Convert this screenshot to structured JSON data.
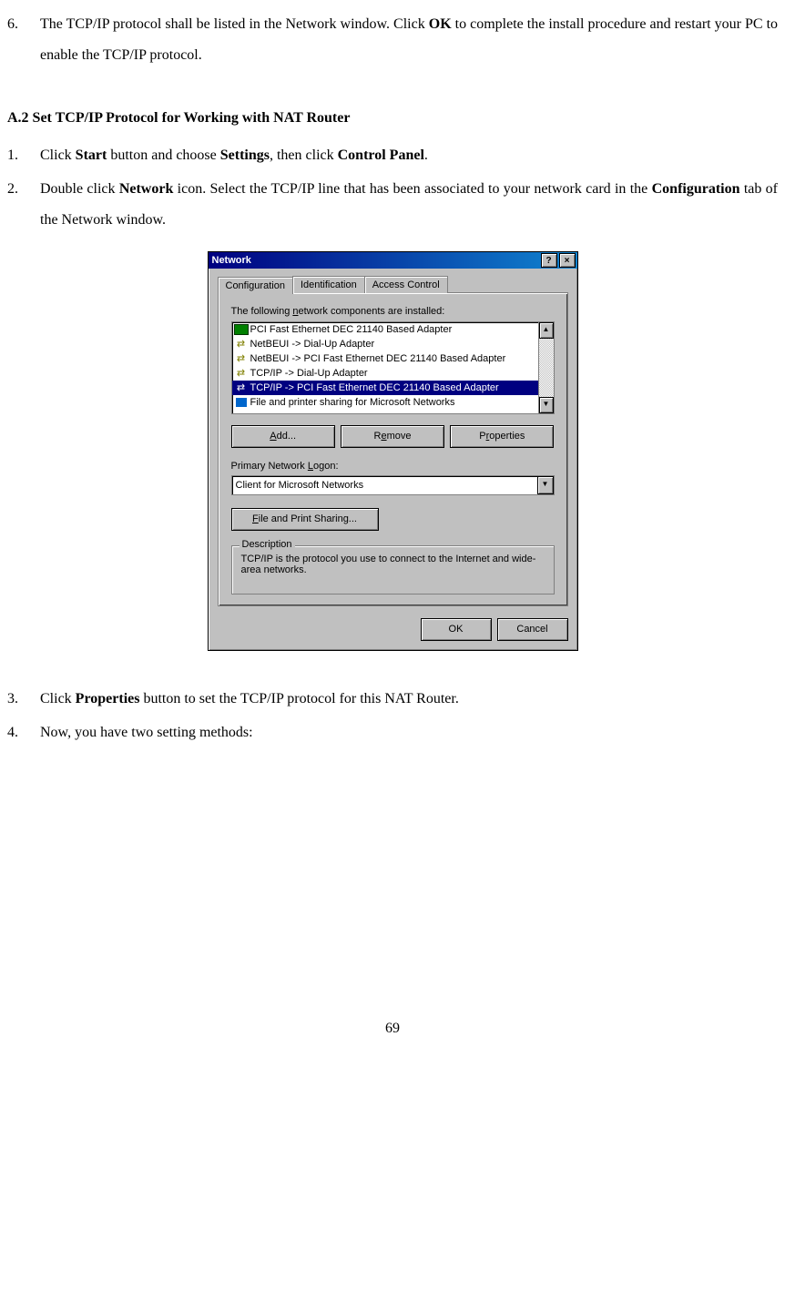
{
  "doc": {
    "item6_num": "6.",
    "item6_pre": "The TCP/IP protocol shall be listed in the Network window. Click ",
    "item6_bold": "OK",
    "item6_post": " to complete the install procedure and restart your PC to enable the TCP/IP protocol.",
    "heading_a2": "A.2 Set TCP/IP Protocol for Working with NAT Router",
    "s1_num": "1.",
    "s1_a": "Click ",
    "s1_b1": "Start",
    "s1_c": " button and choose ",
    "s1_b2": "Settings",
    "s1_d": ", then click ",
    "s1_b3": "Control Panel",
    "s1_e": ".",
    "s2_num": "2.",
    "s2_a": "Double click ",
    "s2_b1": "Network",
    "s2_c": " icon. Select the TCP/IP line that has been associated to your network card in the ",
    "s2_b2": "Configuration",
    "s2_d": " tab of the Network window.",
    "s3_num": "3.",
    "s3_a": "Click ",
    "s3_b1": "Properties",
    "s3_c": " button to set the TCP/IP protocol for this NAT Router.",
    "s4_num": "4.",
    "s4_a": "Now, you have two setting methods:",
    "page_number": "69"
  },
  "dialog": {
    "title": "Network",
    "help_btn": "?",
    "close_btn": "×",
    "tabs": {
      "configuration": "Configuration",
      "identification": "Identification",
      "access_control": "Access Control"
    },
    "components_label_pre": "The following ",
    "components_label_ul": "n",
    "components_label_post": "etwork components are installed:",
    "list": [
      "PCI Fast Ethernet DEC 21140 Based Adapter",
      "NetBEUI -> Dial-Up Adapter",
      "NetBEUI -> PCI Fast Ethernet DEC 21140 Based Adapter",
      "TCP/IP -> Dial-Up Adapter",
      "TCP/IP -> PCI Fast Ethernet DEC 21140 Based Adapter",
      "File and printer sharing for Microsoft Networks"
    ],
    "btn_add_ul": "A",
    "btn_add_post": "dd...",
    "btn_remove_pre": "R",
    "btn_remove_ul": "e",
    "btn_remove_post": "move",
    "btn_props_pre": "P",
    "btn_props_ul": "r",
    "btn_props_post": "operties",
    "logon_label_pre": "Primary Network ",
    "logon_label_ul": "L",
    "logon_label_post": "ogon:",
    "logon_value": "Client for Microsoft Networks",
    "fps_ul": "F",
    "fps_post": "ile and Print Sharing...",
    "desc_title": "Description",
    "desc_text": "TCP/IP is the protocol you use to connect to the Internet and wide-area networks.",
    "btn_ok": "OK",
    "btn_cancel": "Cancel"
  }
}
